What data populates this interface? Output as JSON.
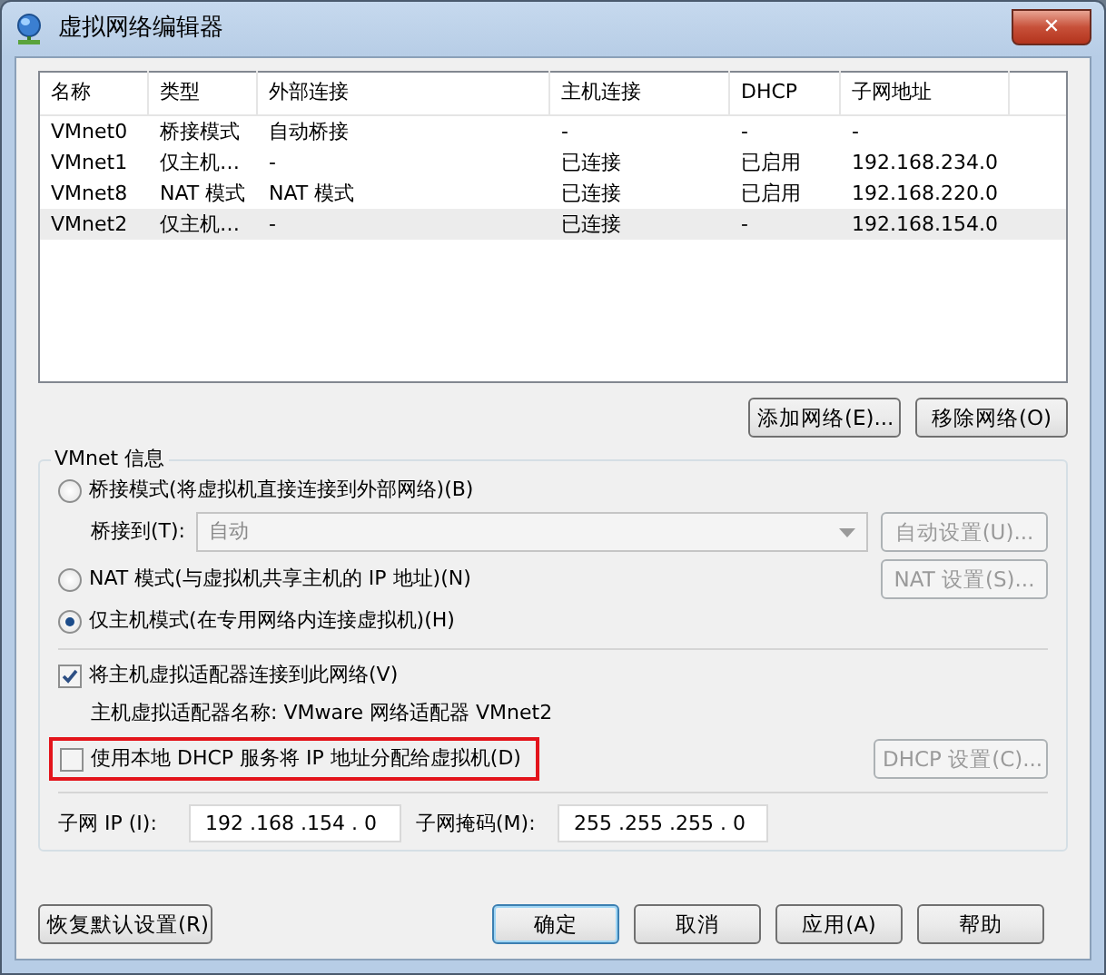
{
  "window": {
    "title": "虚拟网络编辑器",
    "close": "✕"
  },
  "table": {
    "columns": [
      "名称",
      "类型",
      "外部连接",
      "主机连接",
      "DHCP",
      "子网地址"
    ],
    "rows": [
      {
        "cells": [
          "VMnet0",
          "桥接模式",
          "自动桥接",
          "-",
          "-",
          "-"
        ],
        "selected": false
      },
      {
        "cells": [
          "VMnet1",
          "仅主机…",
          "-",
          "已连接",
          "已启用",
          "192.168.234.0"
        ],
        "selected": false
      },
      {
        "cells": [
          "VMnet8",
          "NAT 模式",
          "NAT 模式",
          "已连接",
          "已启用",
          "192.168.220.0"
        ],
        "selected": false
      },
      {
        "cells": [
          "VMnet2",
          "仅主机…",
          "-",
          "已连接",
          "-",
          "192.168.154.0"
        ],
        "selected": true
      }
    ]
  },
  "list_buttons": [
    "添加网络(E)...",
    "移除网络(O)"
  ],
  "vmnet_info": {
    "title": "VMnet 信息",
    "bridged": {
      "label": "桥接模式(将虚拟机直接连接到外部网络)(B)",
      "selected": false
    },
    "bridge_to": {
      "label": "桥接到(T):",
      "value": "自动",
      "disabled": true,
      "button": "自动设置(U)..."
    },
    "nat": {
      "label": "NAT 模式(与虚拟机共享主机的 IP 地址)(N)",
      "selected": false,
      "button": "NAT 设置(S)..."
    },
    "host_only": {
      "label": "仅主机模式(在专用网络内连接虚拟机)(H)",
      "selected": true
    },
    "connect_adapter": {
      "label": "将主机虚拟适配器连接到此网络(V)",
      "checked": true
    },
    "adapter_name": "主机虚拟适配器名称: VMware 网络适配器 VMnet2",
    "dhcp": {
      "label": "使用本地 DHCP 服务将 IP 地址分配给虚拟机(D)",
      "checked": false,
      "highlighted": true,
      "button": "DHCP 设置(C)..."
    },
    "subnet_ip": {
      "label": "子网 IP (I):",
      "value": "192 .168 .154 .  0"
    },
    "subnet_mask": {
      "label": "子网掩码(M):",
      "value": "255 .255 .255 .  0"
    }
  },
  "buttons": [
    {
      "label": "恢复默认设置(R)",
      "default": false
    },
    {
      "label": "确定",
      "default": true
    },
    {
      "label": "取消",
      "default": false
    },
    {
      "label": "应用(A)",
      "default": false
    },
    {
      "label": "帮助",
      "default": false
    }
  ]
}
